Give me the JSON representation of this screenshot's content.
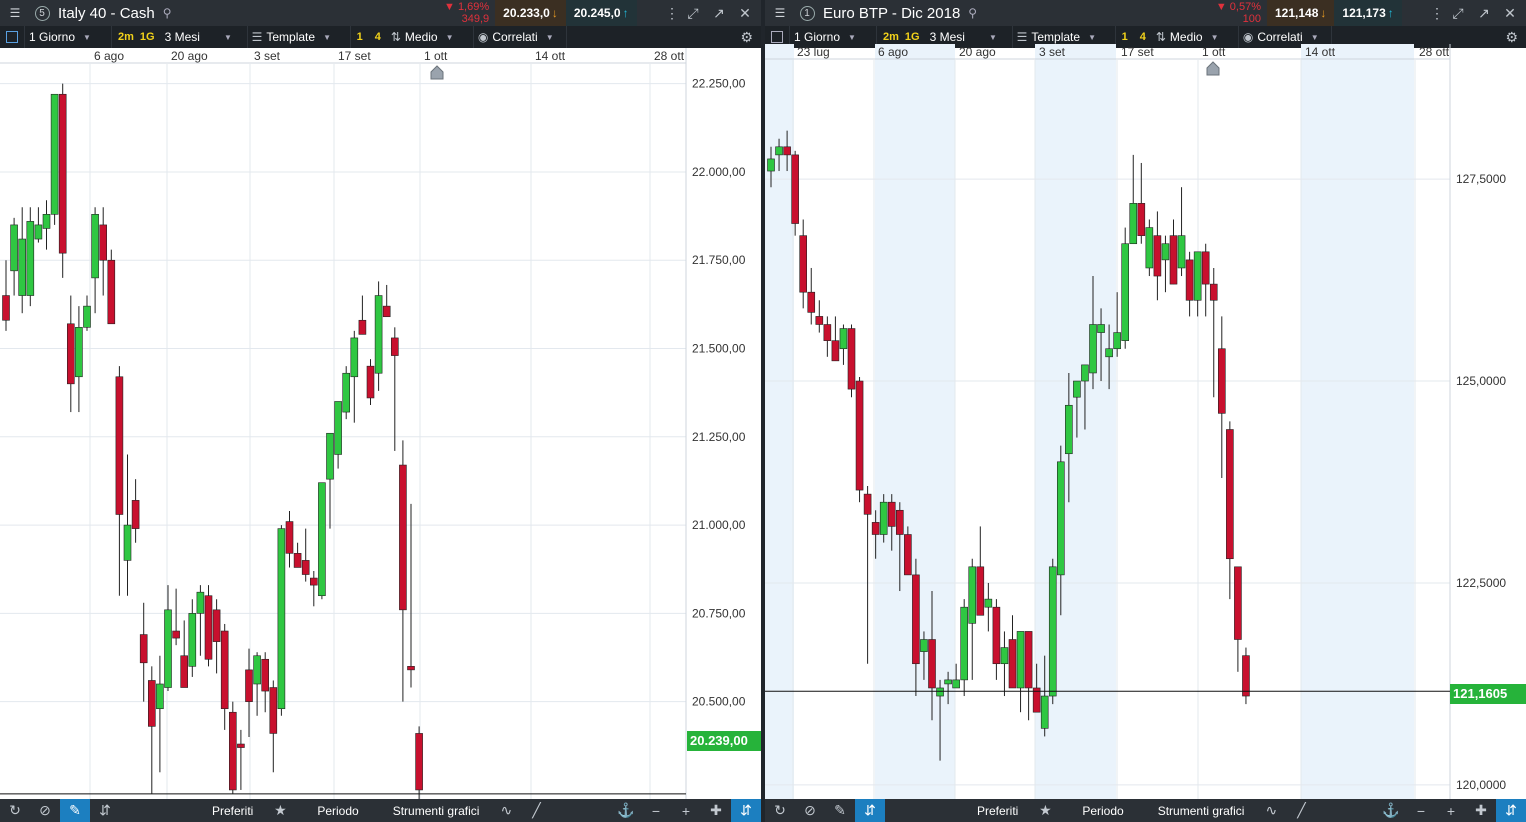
{
  "colors": {
    "up": "#2fc742",
    "down": "#c8102e",
    "grid": "#e3e8ee",
    "axis_text": "#333333",
    "shade": "#eaf3fb",
    "current": "#26b33a"
  },
  "left": {
    "panel_number": "5",
    "title": "Italy 40 - Cash",
    "change_pct": "▼ 1,69%",
    "change_abs": "349,9",
    "sell": "20.233,0",
    "buy": "20.245,0",
    "toolbar": {
      "interval": "1 Giorno",
      "i2m": "2m",
      "i1g": "1G",
      "period": "3 Mesi",
      "template": "Template",
      "n1": "1",
      "n4": "4",
      "medio": "Medio",
      "correlati": "Correlati"
    },
    "current_price": "20.239,00",
    "x_ticks": [
      "6 ago",
      "20 ago",
      "3 set",
      "17 set",
      "1 ott",
      "14 ott",
      "28 ott"
    ],
    "y_ticks": [
      "22.250,00",
      "22.000,00",
      "21.750,00",
      "21.500,00",
      "21.250,00",
      "21.000,00",
      "20.750,00",
      "20.500,00"
    ],
    "bottom": {
      "preferiti": "Preferiti",
      "periodo": "Periodo",
      "strumenti": "Strumenti grafici"
    }
  },
  "right": {
    "panel_number": "1",
    "title": "Euro BTP - Dic 2018",
    "change_pct": "▼ 0,57%",
    "change_abs": "100",
    "sell": "121,148",
    "buy": "121,173",
    "toolbar": {
      "interval": "1 Giorno",
      "i2m": "2m",
      "i1g": "1G",
      "period": "3 Mesi",
      "template": "Template",
      "n1": "1",
      "n4": "4",
      "medio": "Medio",
      "correlati": "Correlati"
    },
    "current_price": "121,1605",
    "x_ticks": [
      "23 lug",
      "6 ago",
      "20 ago",
      "3 set",
      "17 set",
      "1 ott",
      "14 ott",
      "28 ott"
    ],
    "y_ticks": [
      "127,5000",
      "125,0000",
      "122,5000",
      "120,0000"
    ],
    "bottom": {
      "preferiti": "Preferiti",
      "periodo": "Periodo",
      "strumenti": "Strumenti grafici"
    }
  },
  "chart_data": [
    {
      "type": "candlestick",
      "title": "Italy 40 - Cash",
      "ylim": [
        20230,
        22300
      ],
      "x_ticks": [
        "6 ago",
        "20 ago",
        "3 set",
        "17 set",
        "1 ott",
        "14 ott",
        "28 ott"
      ],
      "y_ticks": [
        22250,
        22000,
        21750,
        21500,
        21250,
        21000,
        20750,
        20500
      ],
      "current": 20239,
      "candles": [
        [
          21650,
          21750,
          21550,
          21580
        ],
        [
          21720,
          21870,
          21650,
          21850
        ],
        [
          21650,
          21900,
          21600,
          21810
        ],
        [
          21650,
          21900,
          21620,
          21860
        ],
        [
          21810,
          21900,
          21800,
          21850
        ],
        [
          21840,
          21920,
          21780,
          21880
        ],
        [
          21880,
          22200,
          21850,
          22220
        ],
        [
          22220,
          22250,
          21700,
          21770
        ],
        [
          21570,
          21650,
          21320,
          21400
        ],
        [
          21420,
          21620,
          21320,
          21560
        ],
        [
          21560,
          21650,
          21550,
          21620
        ],
        [
          21700,
          21900,
          21600,
          21880
        ],
        [
          21850,
          21900,
          21650,
          21750
        ],
        [
          21750,
          21780,
          21600,
          21570
        ],
        [
          21420,
          21450,
          20800,
          21030
        ],
        [
          20900,
          21200,
          20800,
          21000
        ],
        [
          21070,
          21130,
          20950,
          20990
        ],
        [
          20690,
          20780,
          20500,
          20610
        ],
        [
          20560,
          20600,
          20240,
          20430
        ],
        [
          20480,
          20630,
          20300,
          20550
        ],
        [
          20540,
          20830,
          20530,
          20760
        ],
        [
          20700,
          20820,
          20660,
          20680
        ],
        [
          20630,
          20730,
          20570,
          20540
        ],
        [
          20600,
          20790,
          20570,
          20750
        ],
        [
          20750,
          20830,
          20630,
          20810
        ],
        [
          20800,
          20830,
          20600,
          20620
        ],
        [
          20760,
          20790,
          20580,
          20670
        ],
        [
          20700,
          20720,
          20420,
          20480
        ],
        [
          20470,
          20500,
          20240,
          20250
        ],
        [
          20380,
          20420,
          20250,
          20370
        ],
        [
          20590,
          20650,
          20400,
          20500
        ],
        [
          20550,
          20640,
          20460,
          20630
        ],
        [
          20620,
          20640,
          20470,
          20530
        ],
        [
          20540,
          20560,
          20300,
          20410
        ],
        [
          20480,
          21000,
          20460,
          20990
        ],
        [
          21010,
          21040,
          20880,
          20920
        ],
        [
          20920,
          20950,
          20890,
          20880
        ],
        [
          20900,
          20990,
          20840,
          20860
        ],
        [
          20850,
          20870,
          20770,
          20830
        ],
        [
          20800,
          21120,
          20790,
          21120
        ],
        [
          21130,
          21200,
          20990,
          21260
        ],
        [
          21200,
          21260,
          21160,
          21350
        ],
        [
          21320,
          21450,
          21300,
          21430
        ],
        [
          21420,
          21550,
          21290,
          21530
        ],
        [
          21580,
          21650,
          21550,
          21540
        ],
        [
          21450,
          21470,
          21340,
          21360
        ],
        [
          21430,
          21690,
          21380,
          21650
        ],
        [
          21620,
          21680,
          21590,
          21590
        ],
        [
          21530,
          21560,
          21210,
          21480
        ],
        [
          21170,
          21240,
          20500,
          20760
        ],
        [
          20600,
          21060,
          20540,
          20590
        ],
        [
          20410,
          20430,
          20220,
          20250
        ]
      ]
    },
    {
      "type": "candlestick",
      "title": "Euro BTP - Dic 2018",
      "ylim": [
        119850,
        128950
      ],
      "x_ticks": [
        "23 lug",
        "6 ago",
        "20 ago",
        "3 set",
        "17 set",
        "1 ott",
        "14 ott",
        "28 ott"
      ],
      "y_ticks": [
        127500,
        125000,
        122500,
        120000
      ],
      "current": 121160,
      "candles": [
        [
          127600,
          127900,
          127400,
          127750
        ],
        [
          127800,
          128000,
          127600,
          127900
        ],
        [
          127900,
          128100,
          127600,
          127800
        ],
        [
          127800,
          127850,
          126800,
          126950
        ],
        [
          126800,
          127000,
          125900,
          126100
        ],
        [
          126100,
          126400,
          125700,
          125850
        ],
        [
          125800,
          126000,
          125600,
          125700
        ],
        [
          125700,
          125800,
          125300,
          125500
        ],
        [
          125500,
          125800,
          125300,
          125250
        ],
        [
          125400,
          125700,
          125200,
          125650
        ],
        [
          125650,
          125700,
          124800,
          124900
        ],
        [
          125000,
          125050,
          123500,
          123650
        ],
        [
          123600,
          123700,
          121500,
          123350
        ],
        [
          123250,
          123400,
          122800,
          123100
        ],
        [
          123100,
          123600,
          123000,
          123500
        ],
        [
          123500,
          123600,
          122900,
          123200
        ],
        [
          123400,
          123500,
          122400,
          123100
        ],
        [
          123100,
          123200,
          122600,
          122600
        ],
        [
          122600,
          122800,
          121100,
          121500
        ],
        [
          121650,
          121900,
          121300,
          121800
        ],
        [
          121800,
          122400,
          120800,
          121200
        ],
        [
          121100,
          121300,
          120300,
          121200
        ],
        [
          121250,
          121400,
          121000,
          121300
        ],
        [
          121200,
          121500,
          121300,
          121300
        ],
        [
          121300,
          122300,
          121100,
          122200
        ],
        [
          122000,
          122800,
          121300,
          122700
        ],
        [
          122700,
          123200,
          122100,
          122100
        ],
        [
          122200,
          122500,
          121900,
          122300
        ],
        [
          122200,
          122300,
          121300,
          121500
        ],
        [
          121500,
          121900,
          121100,
          121700
        ],
        [
          121800,
          122100,
          121200,
          121200
        ],
        [
          121200,
          121900,
          120900,
          121900
        ],
        [
          121900,
          121900,
          120800,
          121200
        ],
        [
          121200,
          121500,
          121100,
          120900
        ],
        [
          120700,
          121600,
          120600,
          121100
        ],
        [
          121100,
          122800,
          121000,
          122700
        ],
        [
          122600,
          124200,
          122100,
          124000
        ],
        [
          124100,
          125100,
          123500,
          124700
        ],
        [
          124800,
          125000,
          124300,
          125000
        ],
        [
          125000,
          125100,
          124400,
          125200
        ],
        [
          125100,
          126300,
          124900,
          125700
        ],
        [
          125600,
          125900,
          125000,
          125700
        ],
        [
          125300,
          125700,
          124900,
          125400
        ],
        [
          125400,
          126100,
          125300,
          125600
        ],
        [
          125500,
          126900,
          125400,
          126700
        ],
        [
          126700,
          127800,
          126700,
          127200
        ],
        [
          127200,
          127700,
          126700,
          126800
        ],
        [
          126400,
          127000,
          126300,
          126900
        ],
        [
          126800,
          127100,
          126000,
          126300
        ],
        [
          126500,
          126800,
          126100,
          126700
        ],
        [
          126800,
          127000,
          126400,
          126200
        ],
        [
          126400,
          127400,
          126300,
          126800
        ],
        [
          126500,
          126600,
          125800,
          126000
        ],
        [
          126000,
          126300,
          125800,
          126600
        ],
        [
          126600,
          126700,
          125800,
          126200
        ],
        [
          126200,
          126400,
          124800,
          126000
        ],
        [
          125400,
          125800,
          123800,
          124600
        ],
        [
          124400,
          124500,
          122300,
          122800
        ],
        [
          122700,
          122400,
          121400,
          121800
        ],
        [
          121600,
          121700,
          121000,
          121100
        ]
      ]
    }
  ]
}
